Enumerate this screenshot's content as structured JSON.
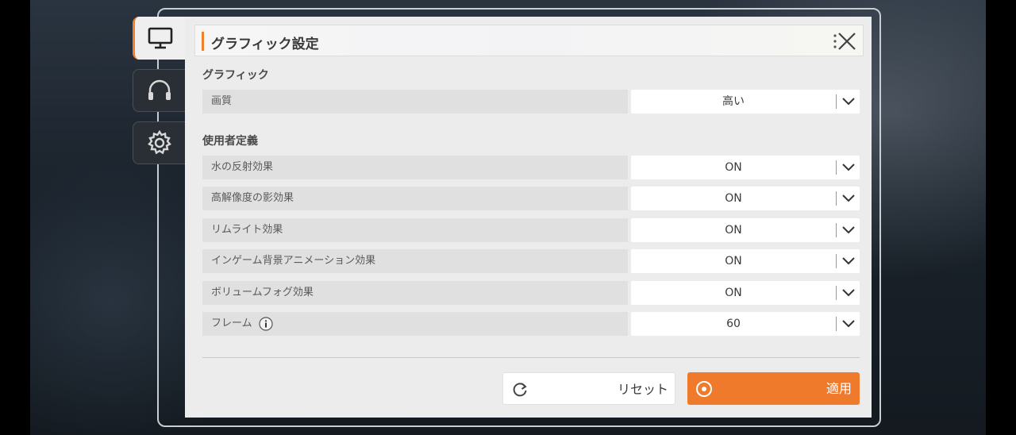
{
  "panel": {
    "title": "グラフィック設定"
  },
  "sidebar": {
    "tabs": [
      {
        "name": "display-icon",
        "active": true
      },
      {
        "name": "headphones-icon",
        "active": false
      },
      {
        "name": "gear-icon",
        "active": false
      }
    ]
  },
  "sections": [
    {
      "label": "グラフィック",
      "rows": [
        {
          "label": "画質",
          "value": "高い"
        }
      ]
    },
    {
      "label": "使用者定義",
      "rows": [
        {
          "label": "水の反射効果",
          "value": "ON"
        },
        {
          "label": "高解像度の影効果",
          "value": "ON"
        },
        {
          "label": "リムライト効果",
          "value": "ON"
        },
        {
          "label": "インゲーム背景アニメーション効果",
          "value": "ON"
        },
        {
          "label": "ボリュームフォグ効果",
          "value": "ON"
        },
        {
          "label": "フレーム",
          "value": "60",
          "info_icon": "info-icon"
        }
      ]
    }
  ],
  "buttons": {
    "reset": "リセット",
    "apply": "適用"
  },
  "colors": {
    "accent": "#f0802c",
    "panel_bg": "#ececec"
  }
}
